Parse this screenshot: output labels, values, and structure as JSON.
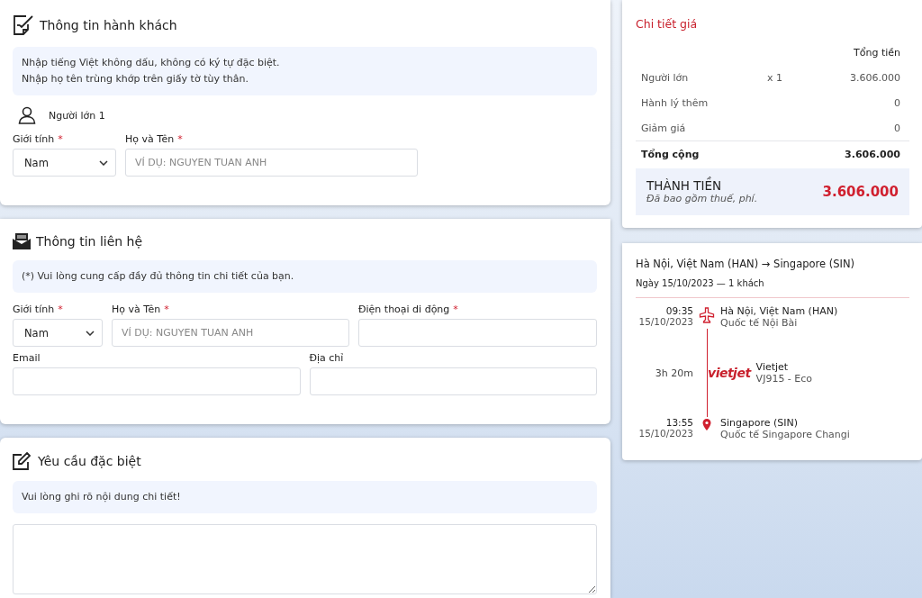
{
  "passenger_section": {
    "title": "Thông tin hành khách",
    "notes": [
      "Nhập tiếng Việt không dấu, không có ký tự đặc biệt.",
      "Nhập họ tên trùng khớp trên giấy tờ tùy thân."
    ],
    "passenger_label": "Người lớn 1",
    "rows": [
      [
        {
          "kind": "select",
          "label": "Giới tính",
          "required_mark": "*",
          "value": "Nam"
        },
        {
          "kind": "text",
          "label": "Họ và Tên",
          "required_mark": "*",
          "placeholder": "VÍ DỤ: NGUYEN TUAN ANH"
        }
      ]
    ]
  },
  "contact_section": {
    "title": "Thông tin liên hệ",
    "notes": [
      "(*) Vui lòng cung cấp đầy đủ thông tin chi tiết của bạn."
    ],
    "rows": [
      [
        {
          "kind": "select",
          "label": "Giới tính",
          "required_mark": "*",
          "value": "Nam"
        },
        {
          "kind": "text",
          "label": "Họ và Tên",
          "required_mark": "*",
          "placeholder": "VÍ DỤ: NGUYEN TUAN ANH"
        },
        {
          "kind": "text",
          "label": "Điện thoại di động",
          "required_mark": "*"
        }
      ],
      [
        {
          "kind": "text",
          "label": "Email"
        },
        {
          "kind": "text",
          "label": "Địa chỉ"
        }
      ]
    ]
  },
  "special_section": {
    "title": "Yêu cầu đặc biệt",
    "notes": [
      "Vui lòng ghi rõ nội dung chi tiết!"
    ]
  },
  "price_details": {
    "title": "Chi tiết giá",
    "column_header": "Tổng tiền",
    "rows": [
      {
        "label": "Người lớn",
        "quantity": "x 1",
        "amount": "3.606.000"
      },
      {
        "label": "Hành lý thêm",
        "amount": "0"
      },
      {
        "label": "Giảm giá",
        "amount": "0"
      }
    ],
    "subtotal": {
      "label": "Tổng cộng",
      "amount": "3.606.000"
    },
    "total": {
      "label": "THÀNH TIỀN",
      "note": "Đã bao gồm thuế, phí.",
      "amount": "3.606.000"
    }
  },
  "flight": {
    "route": "Hà Nội, Việt Nam (HAN) → Singapore (SIN)",
    "date_info": "Ngày 15/10/2023 — 1 khách",
    "departure": {
      "time": "09:35",
      "date": "15/10/2023",
      "city": "Hà Nội, Việt Nam (HAN)",
      "airport": "Quốc tế Nội Bài"
    },
    "duration": "3h 20m",
    "airline_logo": "vietjet",
    "airline": "Vietjet",
    "flight_code": "VJ915 - Eco",
    "arrival": {
      "time": "13:55",
      "date": "15/10/2023",
      "city": "Singapore (SIN)",
      "airport": "Quốc tế Singapore Changi"
    }
  }
}
